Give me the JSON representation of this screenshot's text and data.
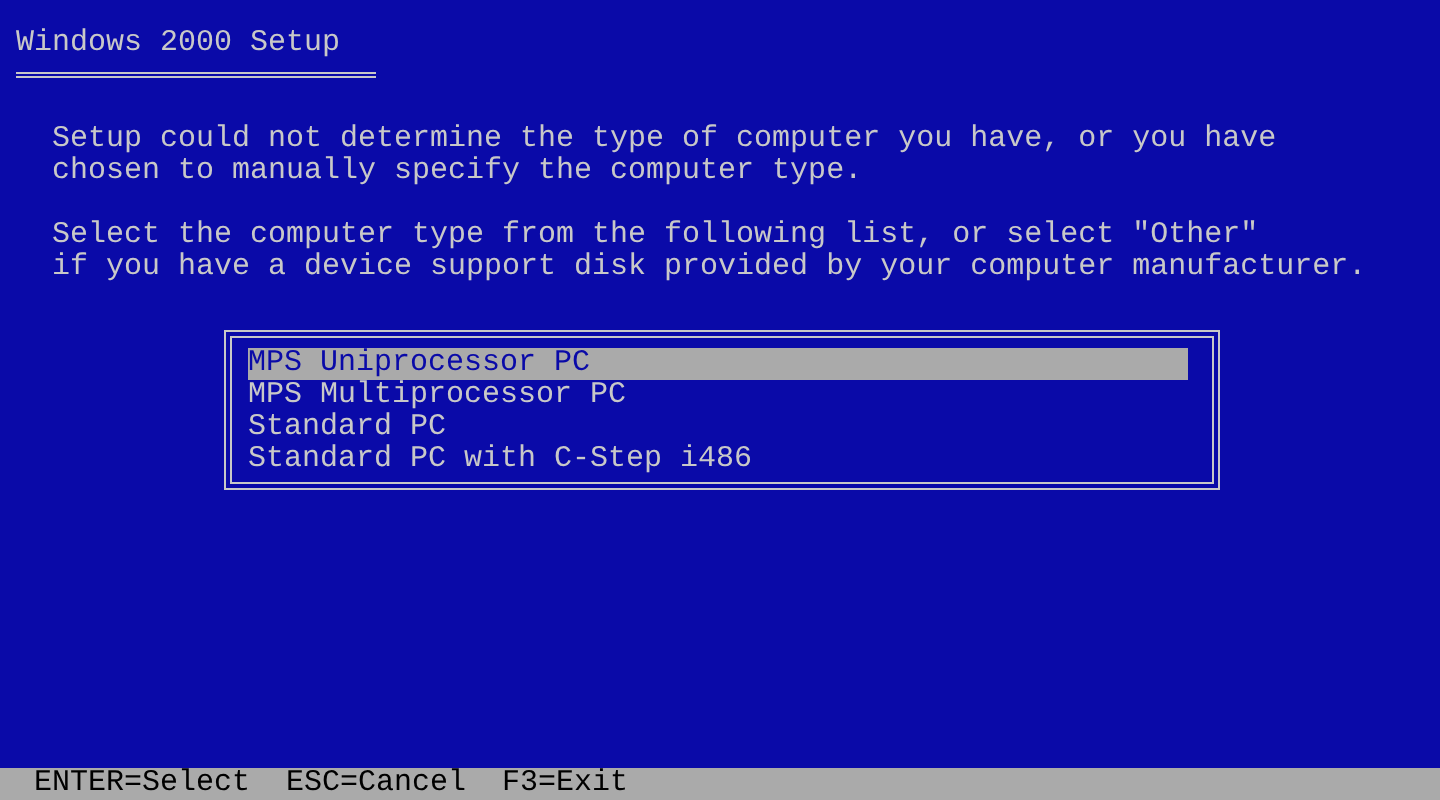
{
  "window": {
    "title": "Windows 2000 Setup"
  },
  "paragraphs": [
    [
      "Setup could not determine the type of computer you have, or you have",
      "chosen to manually specify the computer type."
    ],
    [
      "Select the computer type from the following list, or select \"Other\"",
      "if you have a device support disk provided by your computer manufacturer."
    ]
  ],
  "computer_types": [
    {
      "label": "MPS Uniprocessor PC",
      "selected": true
    },
    {
      "label": "MPS Multiprocessor PC",
      "selected": false
    },
    {
      "label": "Standard PC",
      "selected": false
    },
    {
      "label": "Standard PC with C-Step i486",
      "selected": false
    }
  ],
  "status_bar": [
    "ENTER=Select",
    "ESC=Cancel",
    "F3=Exit"
  ]
}
